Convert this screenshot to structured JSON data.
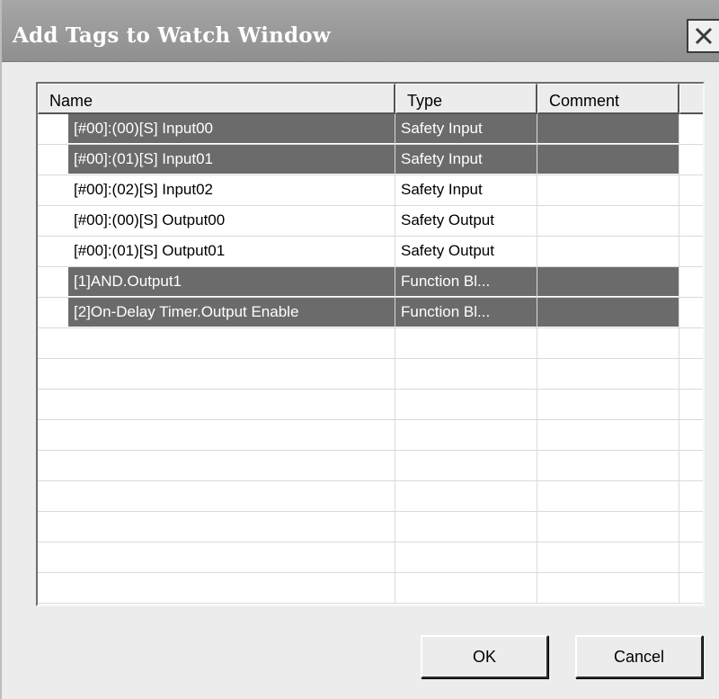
{
  "dialog": {
    "title": "Add Tags to Watch Window",
    "close_icon": "close-icon"
  },
  "table": {
    "columns": [
      "Name",
      "Type",
      "Comment"
    ],
    "rows": [
      {
        "name": "[#00]:(00)[S] Input00",
        "type": "Safety Input",
        "comment": "",
        "selected": true
      },
      {
        "name": "[#00]:(01)[S] Input01",
        "type": "Safety Input",
        "comment": "",
        "selected": true
      },
      {
        "name": "[#00]:(02)[S] Input02",
        "type": "Safety Input",
        "comment": "",
        "selected": false
      },
      {
        "name": "[#00]:(00)[S] Output00",
        "type": "Safety Output",
        "comment": "",
        "selected": false
      },
      {
        "name": "[#00]:(01)[S] Output01",
        "type": "Safety Output",
        "comment": "",
        "selected": false
      },
      {
        "name": "[1]AND.Output1",
        "type": "Function Bl...",
        "comment": "",
        "selected": true
      },
      {
        "name": "[2]On-Delay Timer.Output Enable",
        "type": "Function Bl...",
        "comment": "",
        "selected": true
      }
    ]
  },
  "buttons": {
    "ok_label": "OK",
    "cancel_label": "Cancel"
  },
  "colors": {
    "title_bar": "#8f8f8f",
    "selection": "#6b6b6b",
    "dialog_background": "#ececec"
  }
}
